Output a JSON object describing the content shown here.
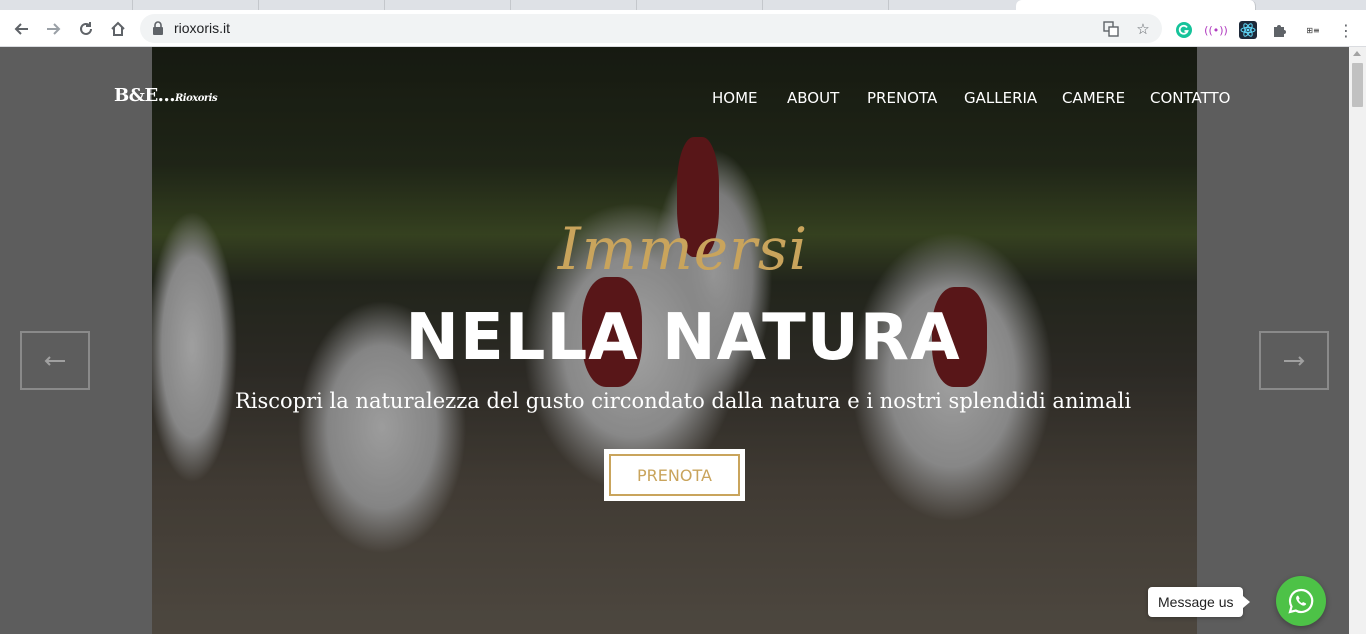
{
  "browser": {
    "url": "rioxoris.it",
    "icons": {
      "back": "arrow-left-icon",
      "forward": "arrow-right-icon",
      "reload": "reload-icon",
      "home": "home-icon",
      "lock": "lock-icon",
      "translate": "translate-icon",
      "bookmark": "star-icon",
      "extensions": [
        "grammarly-icon",
        "podcast-icon",
        "react-devtools-icon",
        "puzzle-icon",
        "extension-icon"
      ],
      "menu": "kebab-menu-icon"
    }
  },
  "site": {
    "logo_main": "B&E...",
    "logo_sub": "Rioxoris",
    "nav": [
      "HOME",
      "ABOUT",
      "PRENOTA",
      "GALLERIA",
      "CAMERE",
      "CONTATTO"
    ]
  },
  "hero": {
    "script_title": "Immersi",
    "title": "NELLA NATURA",
    "subtitle": "Riscopri la naturalezza del gusto circondato dalla natura e i nostri splendidi animali",
    "cta": "PRENOTA",
    "prev_icon": "arrow-left-icon",
    "next_icon": "arrow-right-icon"
  },
  "widget": {
    "message_label": "Message us",
    "icon": "whatsapp-icon"
  },
  "colors": {
    "gold": "#c9a45c",
    "whatsapp": "#4dc247"
  }
}
